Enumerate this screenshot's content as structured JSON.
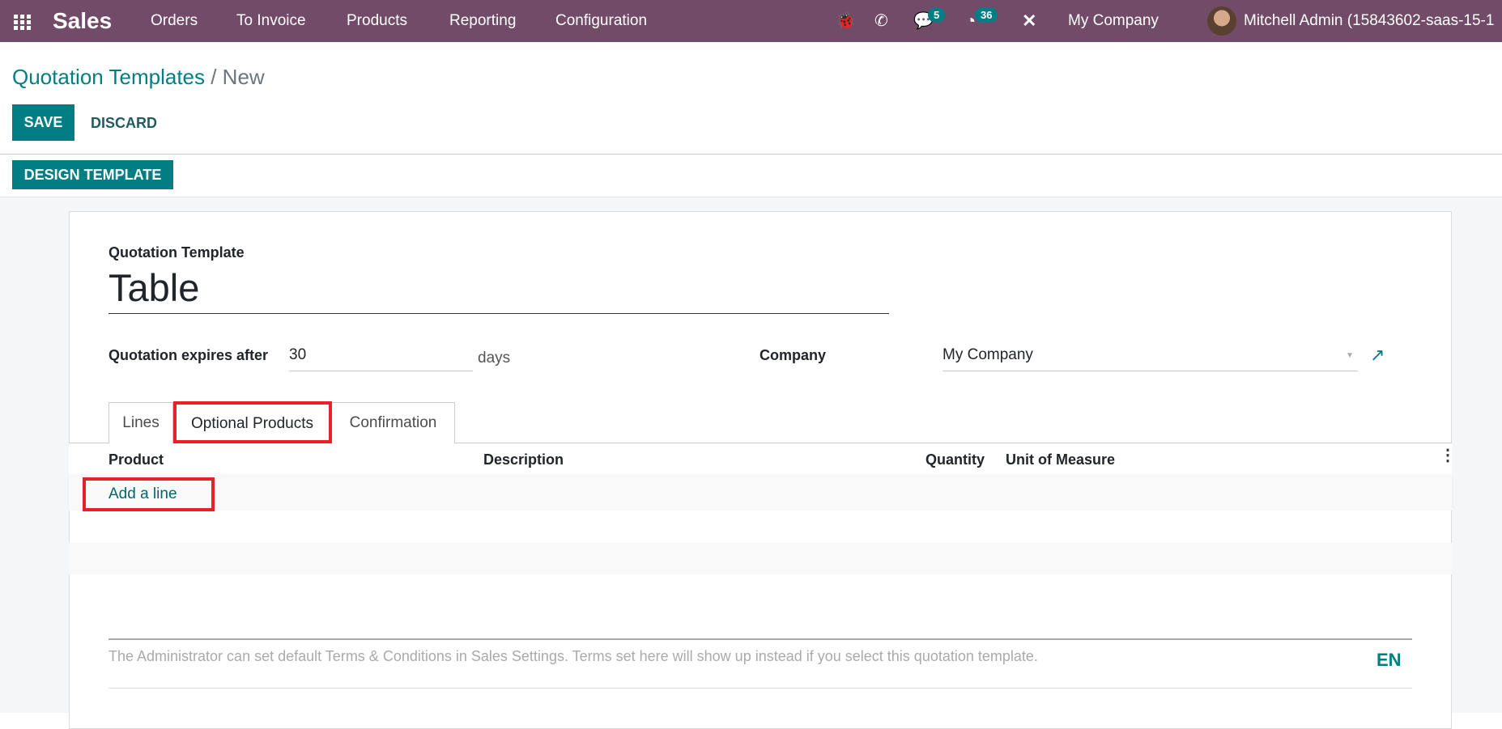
{
  "navbar": {
    "app": "Sales",
    "menu": [
      "Orders",
      "To Invoice",
      "Products",
      "Reporting",
      "Configuration"
    ],
    "messages_count": "5",
    "activities_count": "36",
    "company": "My Company",
    "user": "Mitchell Admin (15843602-saas-15-1",
    "color": "#714b67"
  },
  "breadcrumb": {
    "parent": "Quotation Templates",
    "separator": " / ",
    "current": "New"
  },
  "buttons": {
    "save": "SAVE",
    "discard": "DISCARD",
    "design": "DESIGN TEMPLATE"
  },
  "form": {
    "name_label": "Quotation Template",
    "name_value": "Table",
    "expires_label": "Quotation expires after",
    "expires_value": "30",
    "expires_unit": "days",
    "company_label": "Company",
    "company_value": "My Company"
  },
  "tabs": [
    "Lines",
    "Optional Products",
    "Confirmation"
  ],
  "active_tab": "Optional Products",
  "table": {
    "headers": [
      "Product",
      "Description",
      "Quantity",
      "Unit of Measure"
    ],
    "add_line": "Add a line"
  },
  "terms": {
    "placeholder": "The Administrator can set default Terms & Conditions in Sales Settings. Terms set here will show up instead if you select this quotation template.",
    "lang": "EN"
  },
  "accent": "#017e84",
  "highlight": "#e8202a"
}
